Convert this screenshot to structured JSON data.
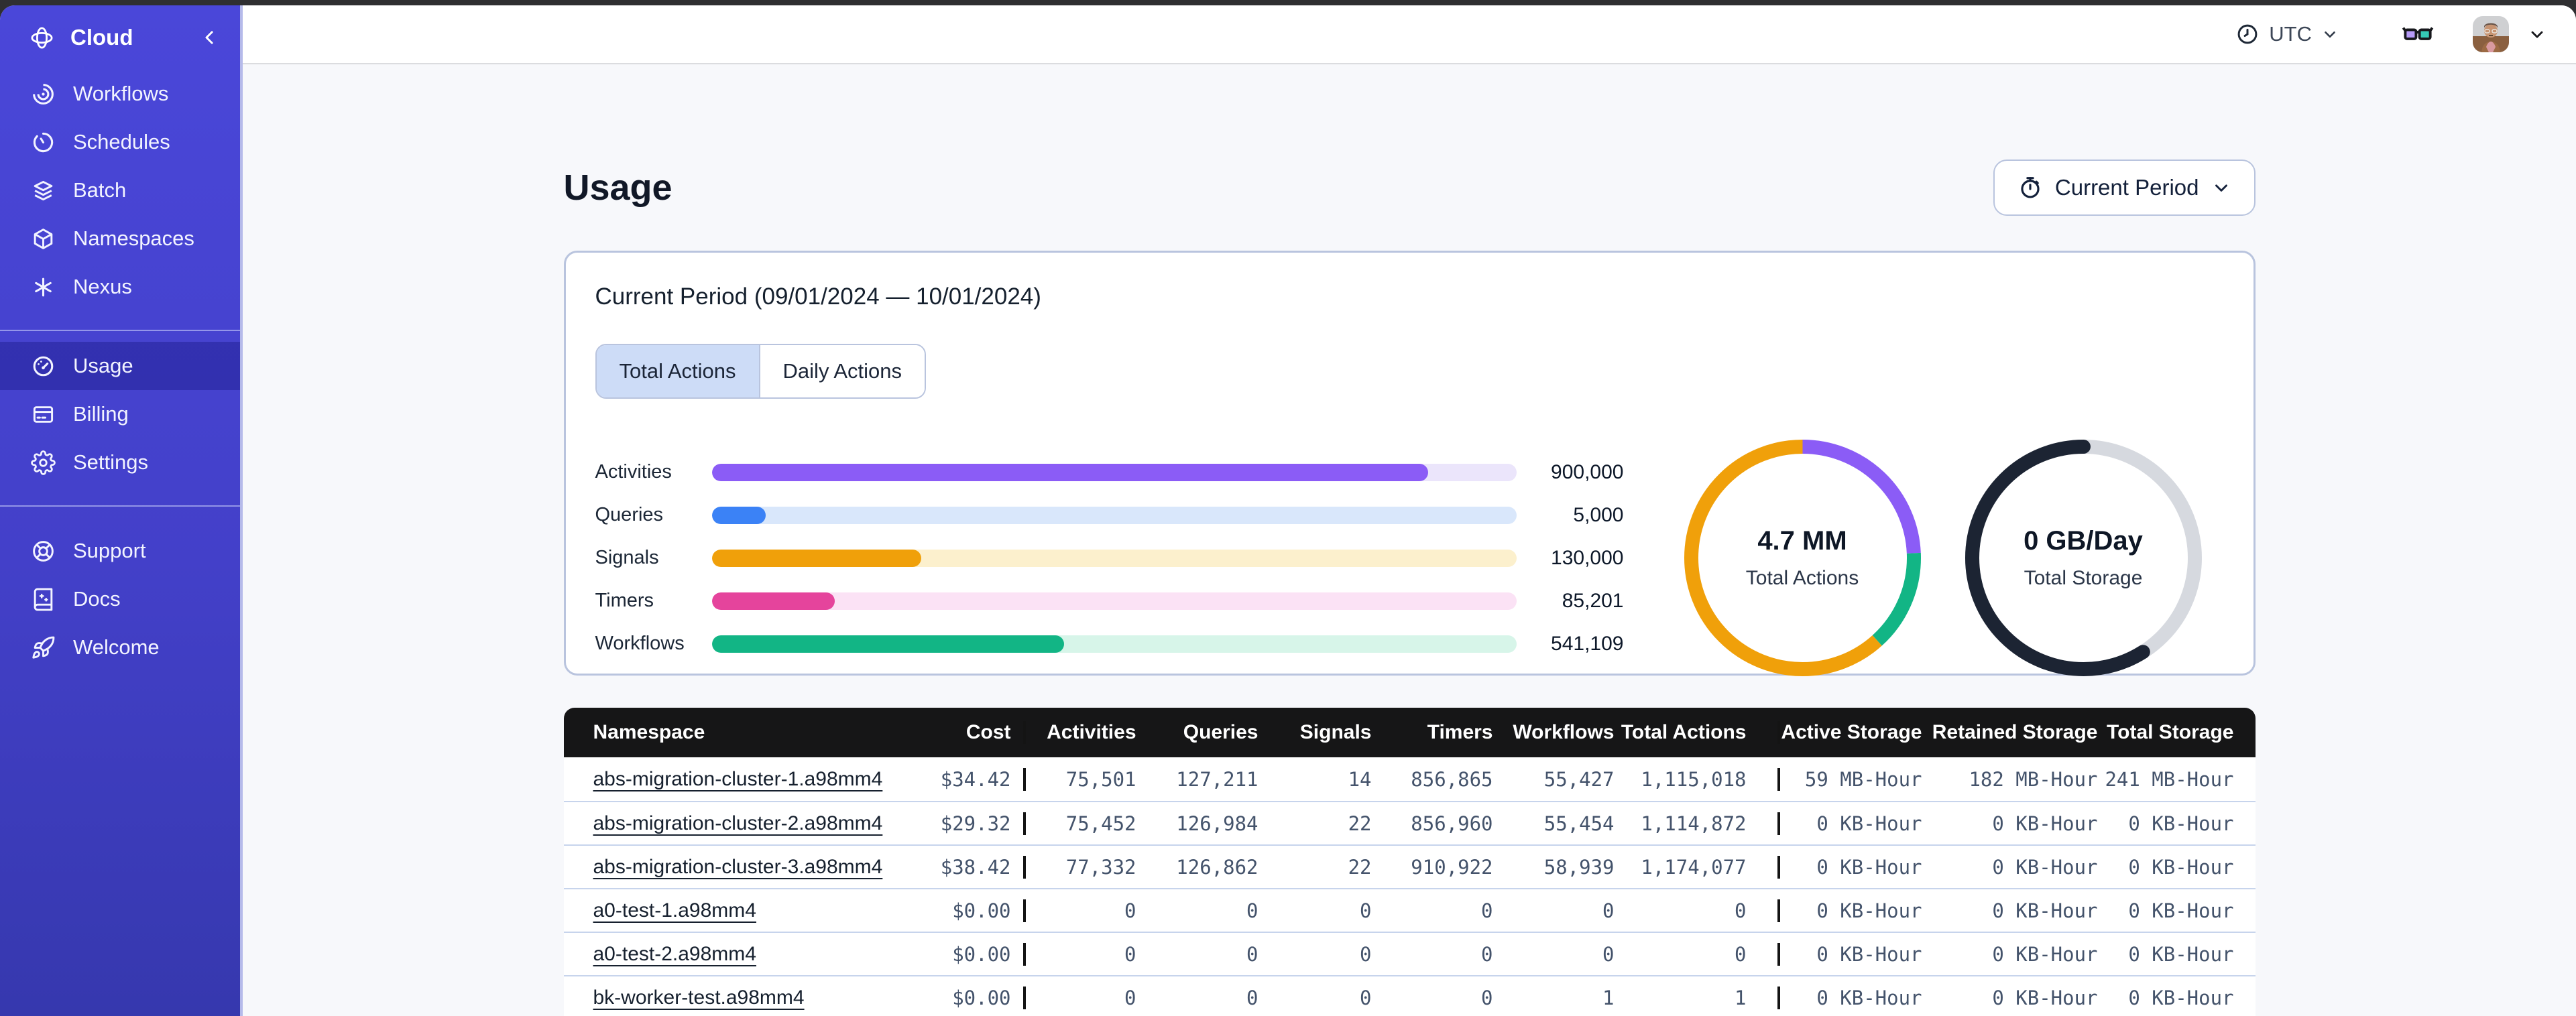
{
  "topbar": {
    "timezone_label": "UTC"
  },
  "sidebar": {
    "brand": "Cloud",
    "nav": [
      {
        "label": "Workflows"
      },
      {
        "label": "Schedules"
      },
      {
        "label": "Batch"
      },
      {
        "label": "Namespaces"
      },
      {
        "label": "Nexus"
      }
    ],
    "account": [
      {
        "label": "Usage",
        "active": true
      },
      {
        "label": "Billing",
        "active": false
      },
      {
        "label": "Settings",
        "active": false
      }
    ],
    "help": [
      {
        "label": "Support"
      },
      {
        "label": "Docs"
      },
      {
        "label": "Welcome"
      }
    ]
  },
  "page": {
    "title": "Usage",
    "period_button_label": "Current Period"
  },
  "usage_card": {
    "title": "Current Period (09/01/2024 — 10/01/2024)",
    "tabs": [
      {
        "label": "Total Actions",
        "active": true
      },
      {
        "label": "Daily Actions",
        "active": false
      }
    ],
    "bars": [
      {
        "label": "Activities",
        "value": "900,000",
        "pct": 89,
        "color": "#8b5cf6",
        "track": "#ebe5fb"
      },
      {
        "label": "Queries",
        "value": "5,000",
        "pct": 6.7,
        "color": "#3b82f6",
        "track": "#d9e7fb"
      },
      {
        "label": "Signals",
        "value": "130,000",
        "pct": 26,
        "color": "#f0a00a",
        "track": "#fcf0cd"
      },
      {
        "label": "Timers",
        "value": "85,201",
        "pct": 15.3,
        "color": "#e5449c",
        "track": "#fbe2f5"
      },
      {
        "label": "Workflows",
        "value": "541,109",
        "pct": 43.8,
        "color": "#12b585",
        "track": "#d7f5e9"
      }
    ],
    "donuts": [
      {
        "value": "4.7 MM",
        "label": "Total Actions",
        "track": null,
        "segments": [
          {
            "color": "#8b5cf6",
            "pct": 24.3
          },
          {
            "color": "#12b585",
            "pct": 14
          },
          {
            "color": "#f0a00a",
            "pct": 61.7
          }
        ]
      },
      {
        "value": "0 GB/Day",
        "label": "Total Storage",
        "track": "#d6d9df",
        "segments": [
          {
            "color": "#1c2433",
            "pct": 59,
            "offset": 41,
            "round": true
          }
        ]
      }
    ]
  },
  "table": {
    "columns": [
      "Namespace",
      "Cost",
      "Activities",
      "Queries",
      "Signals",
      "Timers",
      "Workflows",
      "Total Actions",
      "Active Storage",
      "Retained Storage",
      "Total Storage"
    ],
    "rows": [
      [
        "abs-migration-cluster-1.a98mm4",
        "$34.42",
        "75,501",
        "127,211",
        "14",
        "856,865",
        "55,427",
        "1,115,018",
        "59 MB-Hour",
        "182 MB-Hour",
        "241 MB-Hour"
      ],
      [
        "abs-migration-cluster-2.a98mm4",
        "$29.32",
        "75,452",
        "126,984",
        "22",
        "856,960",
        "55,454",
        "1,114,872",
        "0 KB-Hour",
        "0 KB-Hour",
        "0 KB-Hour"
      ],
      [
        "abs-migration-cluster-3.a98mm4",
        "$38.42",
        "77,332",
        "126,862",
        "22",
        "910,922",
        "58,939",
        "1,174,077",
        "0 KB-Hour",
        "0 KB-Hour",
        "0 KB-Hour"
      ],
      [
        "a0-test-1.a98mm4",
        "$0.00",
        "0",
        "0",
        "0",
        "0",
        "0",
        "0",
        "0 KB-Hour",
        "0 KB-Hour",
        "0 KB-Hour"
      ],
      [
        "a0-test-2.a98mm4",
        "$0.00",
        "0",
        "0",
        "0",
        "0",
        "0",
        "0",
        "0 KB-Hour",
        "0 KB-Hour",
        "0 KB-Hour"
      ],
      [
        "bk-worker-test.a98mm4",
        "$0.00",
        "0",
        "0",
        "0",
        "0",
        "1",
        "1",
        "0 KB-Hour",
        "0 KB-Hour",
        "0 KB-Hour"
      ]
    ]
  }
}
